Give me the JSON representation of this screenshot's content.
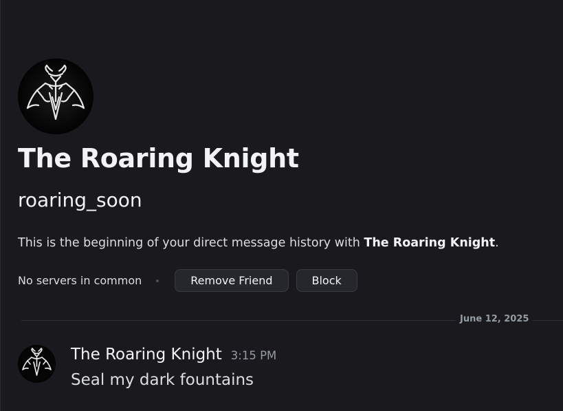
{
  "profile": {
    "display_name": "The Roaring Knight",
    "username": "roaring_soon",
    "avatar_icon": "knight-emblem-icon"
  },
  "intro": {
    "prefix": "This is the beginning of your direct message history with ",
    "name": "The Roaring Knight",
    "suffix": "."
  },
  "actions": {
    "mutual_servers": "No servers in common",
    "remove_friend_label": "Remove Friend",
    "block_label": "Block"
  },
  "divider": {
    "date": "June 12, 2025"
  },
  "messages": [
    {
      "author": "The Roaring Knight",
      "time": "3:15 PM",
      "content": "Seal my dark fountains"
    }
  ],
  "colors": {
    "background": "#1a1a1e",
    "button_bg": "#26272c",
    "muted_text": "#949ba4",
    "primary_text": "#f2f3f5"
  }
}
